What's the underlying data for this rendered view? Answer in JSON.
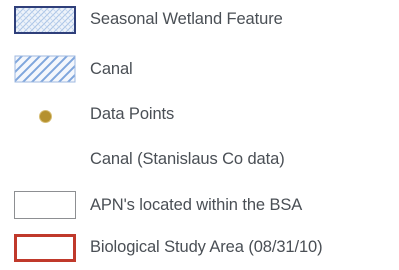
{
  "legend": {
    "items": [
      {
        "label": "Seasonal Wetland Feature",
        "symbol": "blue-crosshatch-fill"
      },
      {
        "label": "Canal",
        "symbol": "blue-diagonal-hatch-fill"
      },
      {
        "label": "Data Points",
        "symbol": "orange-dot"
      },
      {
        "label": "Canal (Stanislaus Co data)",
        "symbol": "none"
      },
      {
        "label": "APN's located within the BSA",
        "symbol": "gray-outline-box"
      },
      {
        "label": "Biological Study Area (08/31/10)",
        "symbol": "red-outline-box"
      }
    ]
  },
  "colors": {
    "wetland_outline": "#2f3f7a",
    "wetland_hatch": "#a9c3e6",
    "canal_hatch": "#7fa6dc",
    "data_point": "#b5912e",
    "apn_outline": "#8d8f92",
    "bsa_outline": "#c0392b",
    "label_text": "#4a4f55"
  }
}
